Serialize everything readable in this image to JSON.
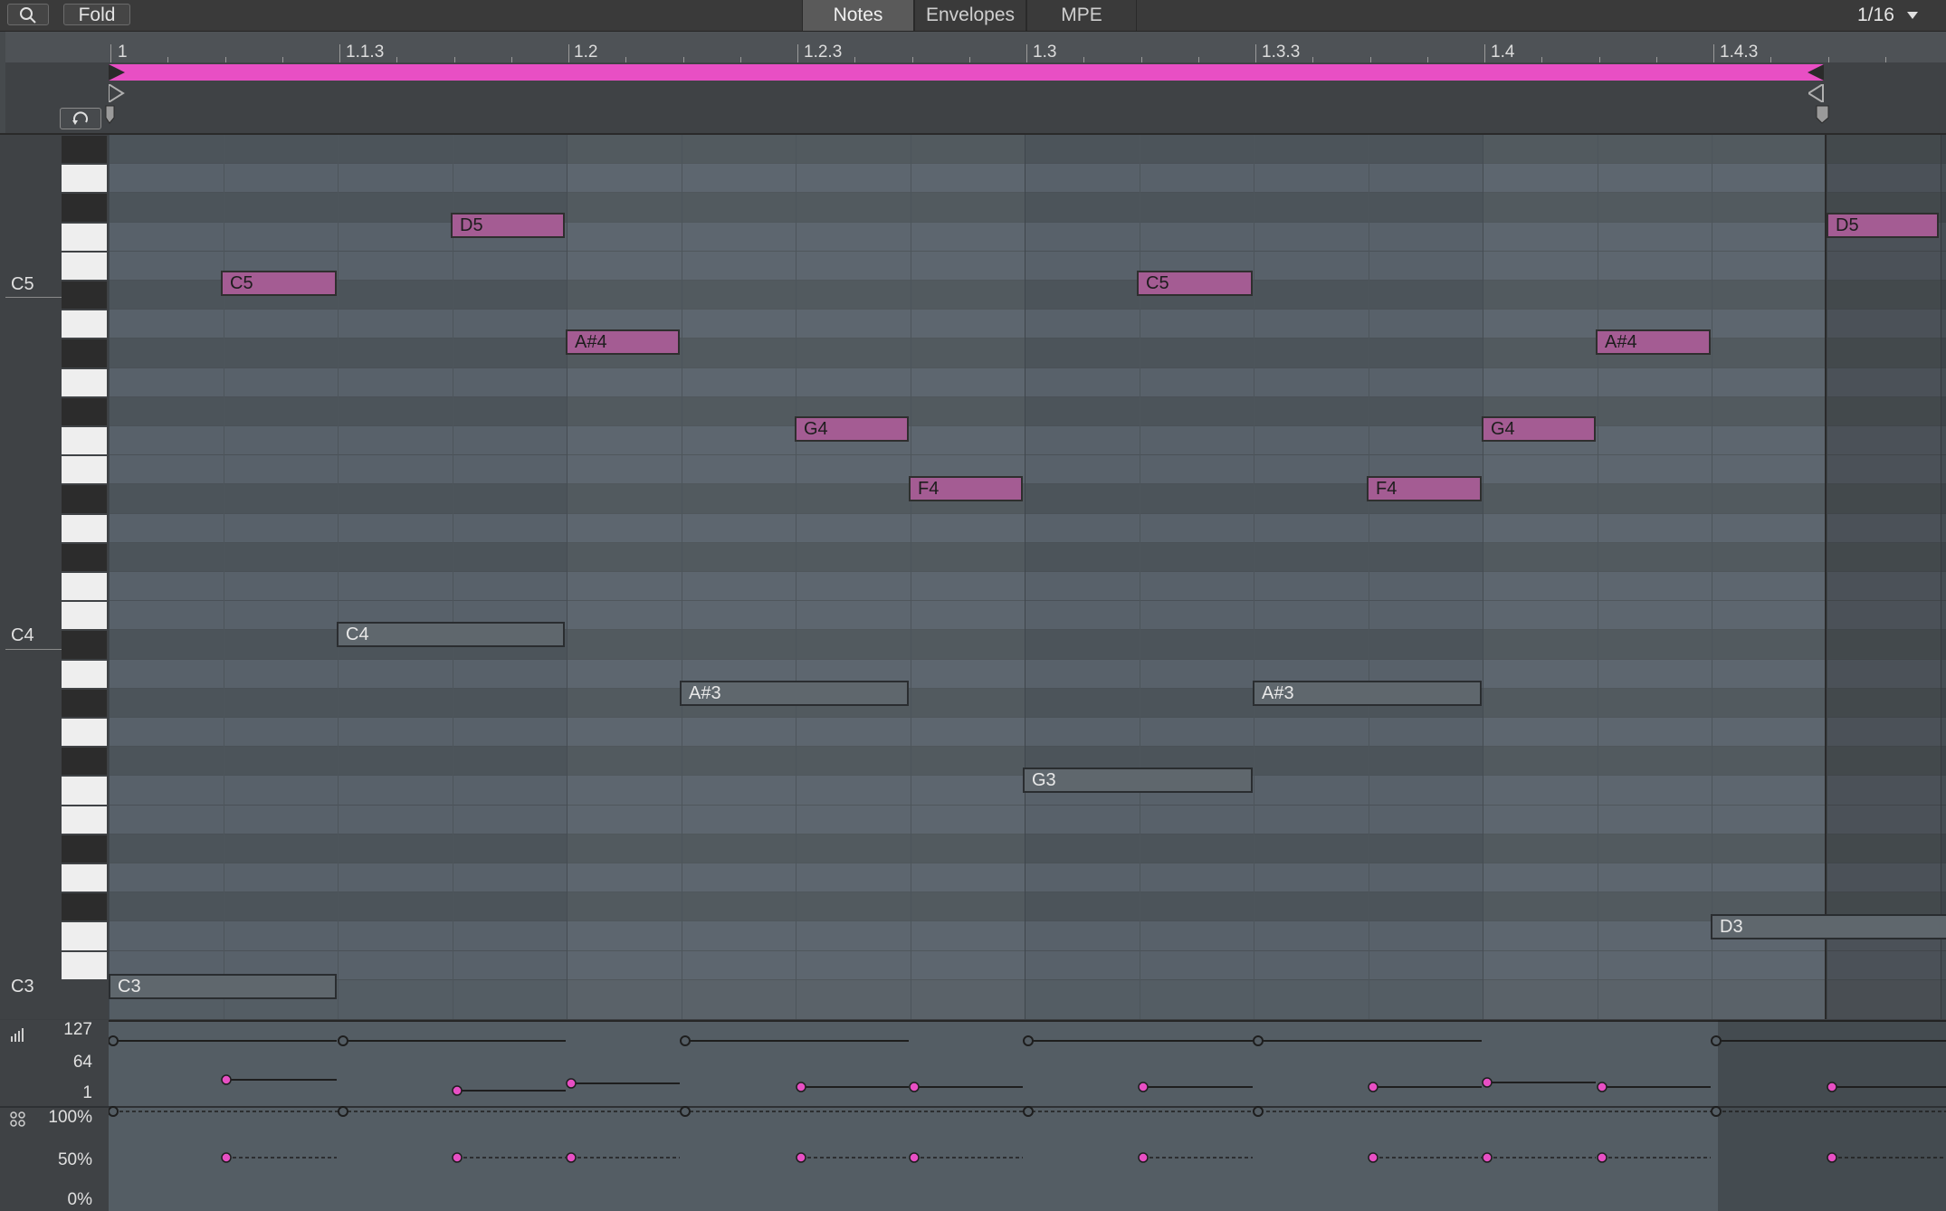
{
  "toolbar": {
    "search_icon": "search-icon",
    "fold_label": "Fold",
    "tabs": [
      {
        "label": "Notes",
        "active": true
      },
      {
        "label": "Envelopes",
        "active": false
      },
      {
        "label": "MPE",
        "active": false
      }
    ],
    "grid_value": "1/16",
    "grid_dropdown_icon": "triangle-down-icon"
  },
  "ruler": {
    "labels": [
      "1",
      "1.1.3",
      "1.2",
      "1.2.3",
      "1.3",
      "1.3.3",
      "1.4",
      "1.4.3"
    ],
    "loop_color": "#e84fc4",
    "loop_icon": "loop-icon"
  },
  "piano": {
    "octave_labels": [
      "C5",
      "C4",
      "C3"
    ]
  },
  "notes": [
    {
      "label": "D5",
      "color": "pink"
    },
    {
      "label": "C5",
      "color": "pink"
    },
    {
      "label": "A#4",
      "color": "pink"
    },
    {
      "label": "G4",
      "color": "pink"
    },
    {
      "label": "F4",
      "color": "pink"
    },
    {
      "label": "C4",
      "color": "grey"
    },
    {
      "label": "A#3",
      "color": "grey"
    },
    {
      "label": "G3",
      "color": "grey"
    },
    {
      "label": "C5",
      "color": "pink"
    },
    {
      "label": "A#3",
      "color": "grey"
    },
    {
      "label": "F4",
      "color": "pink"
    },
    {
      "label": "G4",
      "color": "pink"
    },
    {
      "label": "A#4",
      "color": "pink"
    },
    {
      "label": "D3",
      "color": "grey"
    },
    {
      "label": "D5",
      "color": "pink"
    },
    {
      "label": "C3",
      "color": "grey"
    }
  ],
  "lanes": {
    "velocity_icon": "velocity-bars-icon",
    "velocity_labels": [
      "127",
      "64",
      "1"
    ],
    "chance_icon": "chance-icon",
    "chance_labels": [
      "100%",
      "50%",
      "0%"
    ]
  },
  "colors": {
    "accent": "#e84fc4",
    "note_pink": "#a45c93",
    "grid_bg": "#545d64"
  }
}
